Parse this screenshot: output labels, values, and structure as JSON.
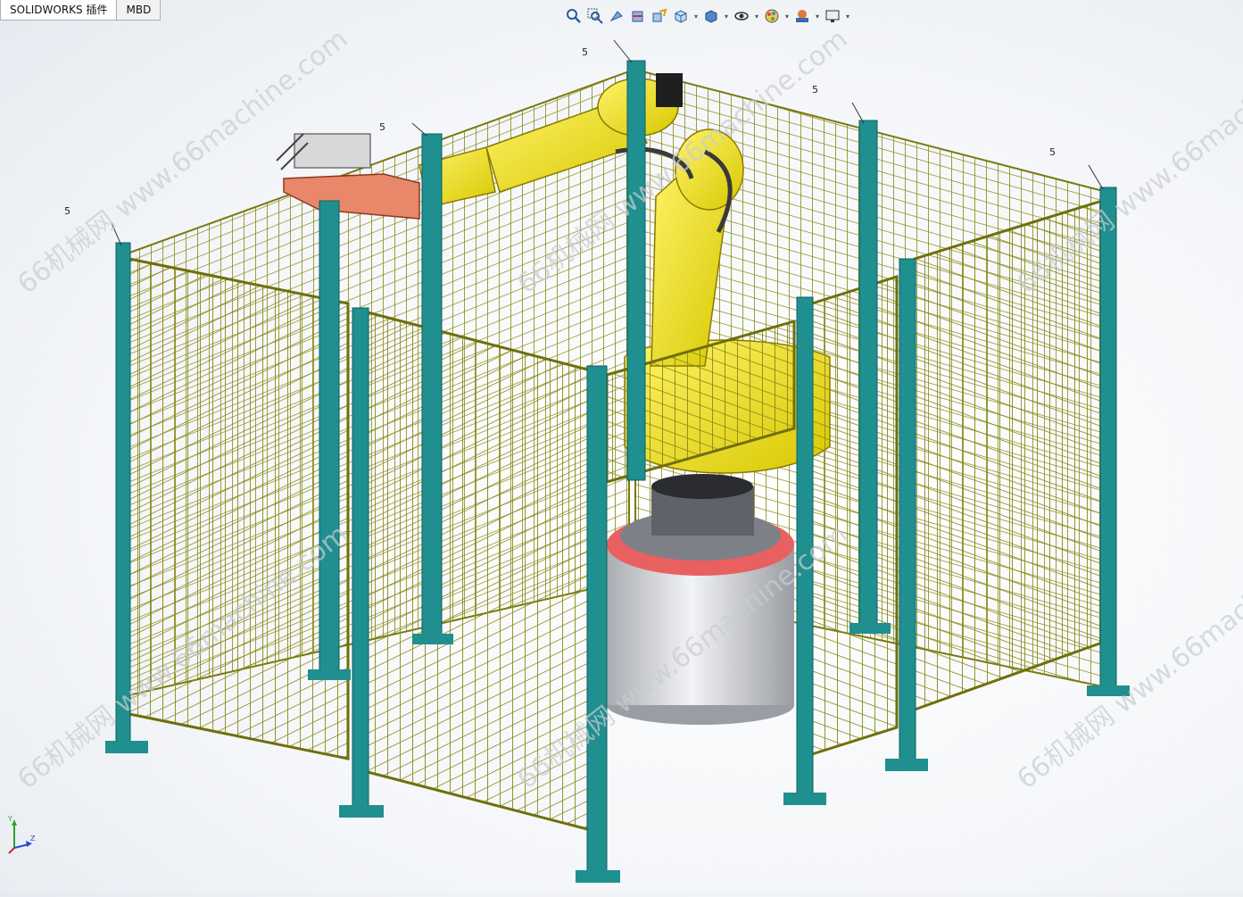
{
  "tabs": [
    {
      "label": "SOLIDWORKS 插件",
      "active": true
    },
    {
      "label": "MBD",
      "active": false
    }
  ],
  "heads_up_toolbar": [
    {
      "icon": "zoom-to-fit-icon",
      "dropdown": false
    },
    {
      "icon": "zoom-to-area-icon",
      "dropdown": false
    },
    {
      "icon": "previous-view-icon",
      "dropdown": false
    },
    {
      "icon": "section-view-icon",
      "dropdown": false
    },
    {
      "icon": "dynamic-annotation-icon",
      "dropdown": false
    },
    {
      "icon": "view-orientation-icon",
      "dropdown": true
    },
    {
      "icon": "display-style-icon",
      "dropdown": true
    },
    {
      "icon": "hide-show-items-icon",
      "dropdown": true
    },
    {
      "icon": "edit-appearance-icon",
      "dropdown": true
    },
    {
      "icon": "apply-scene-icon",
      "dropdown": true
    },
    {
      "icon": "view-settings-icon",
      "dropdown": true
    }
  ],
  "watermark": "66机械网 www.66machine.com",
  "balloon_labels": [
    "5",
    "5",
    "5",
    "5",
    "5"
  ],
  "triad_labels": {
    "y": "Y",
    "z": "Z"
  },
  "colors": {
    "fence_mesh": "#8a8a1a",
    "fence_post": "#1f8f8f",
    "robot_yellow": "#f0e020",
    "base_gray": "#c8cbd0",
    "accent_red": "#e86060",
    "tab_border": "#a8b0bb"
  }
}
